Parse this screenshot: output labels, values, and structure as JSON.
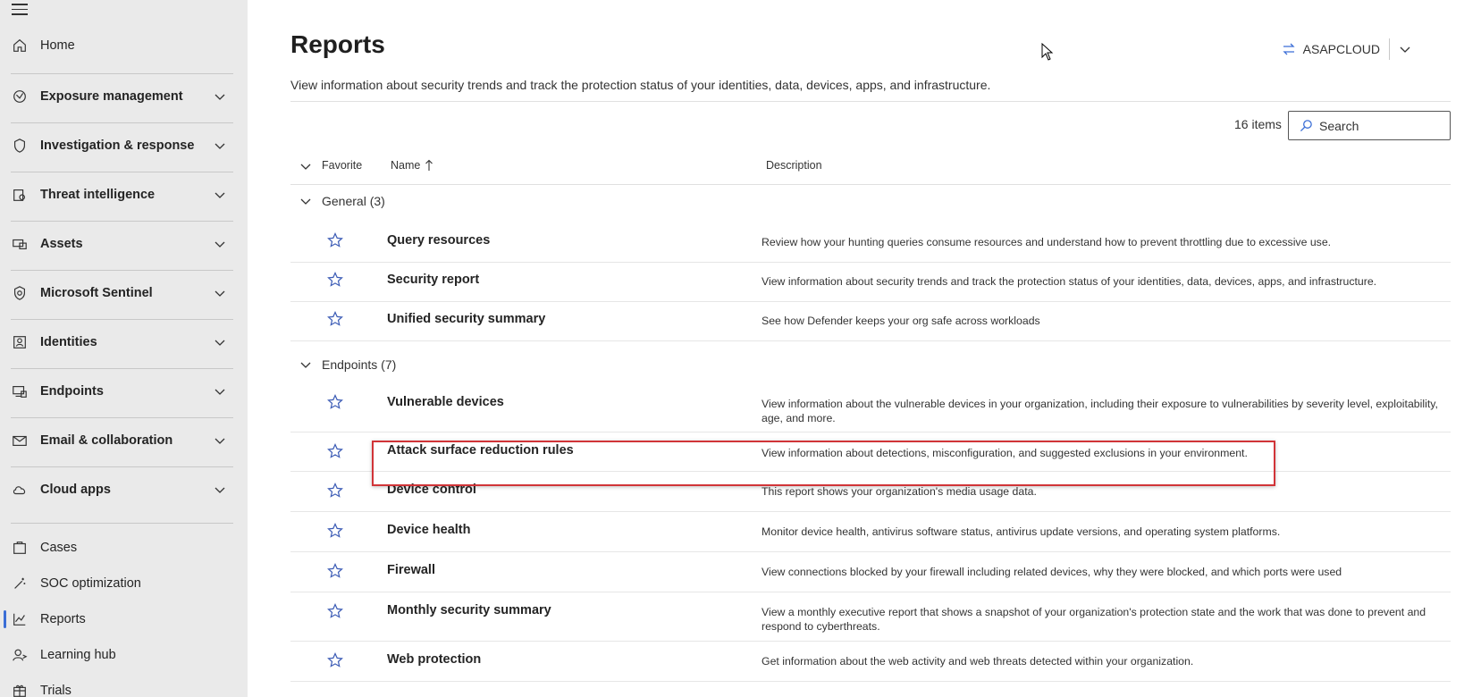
{
  "sidebar": {
    "top_items": [
      {
        "label": "Home",
        "icon": "home-icon"
      }
    ],
    "groups": [
      {
        "label": "Exposure management",
        "icon": "exposure-icon"
      },
      {
        "label": "Investigation & response",
        "icon": "shield-icon"
      },
      {
        "label": "Threat intelligence",
        "icon": "threat-intel-icon"
      },
      {
        "label": "Assets",
        "icon": "assets-icon"
      },
      {
        "label": "Microsoft Sentinel",
        "icon": "sentinel-icon"
      },
      {
        "label": "Identities",
        "icon": "identity-icon"
      },
      {
        "label": "Endpoints",
        "icon": "endpoints-icon"
      },
      {
        "label": "Email & collaboration",
        "icon": "mail-icon"
      },
      {
        "label": "Cloud apps",
        "icon": "cloud-icon"
      }
    ],
    "bottom_items": [
      {
        "label": "Cases",
        "icon": "cases-icon"
      },
      {
        "label": "SOC optimization",
        "icon": "wand-icon"
      },
      {
        "label": "Reports",
        "icon": "chart-icon",
        "active": true
      },
      {
        "label": "Learning hub",
        "icon": "learning-icon"
      },
      {
        "label": "Trials",
        "icon": "trials-icon"
      }
    ]
  },
  "header": {
    "title": "Reports",
    "subtitle": "View information about security trends and track the protection status of your identities, data, devices, apps, and infrastructure.",
    "tenant": "ASAPCLOUD"
  },
  "toolbar": {
    "items_count": "16 items",
    "search_placeholder": "Search"
  },
  "table": {
    "columns": {
      "favorite": "Favorite",
      "name": "Name",
      "description": "Description"
    },
    "groups": [
      {
        "label": "General (3)",
        "rows": [
          {
            "name": "Query resources",
            "description": "Review how your hunting queries consume resources and understand how to prevent throttling due to excessive use."
          },
          {
            "name": "Security report",
            "description": "View information about security trends and track the protection status of your identities, data, devices, apps, and infrastructure."
          },
          {
            "name": "Unified security summary",
            "description": "See how Defender keeps your org safe across workloads"
          }
        ]
      },
      {
        "label": "Endpoints (7)",
        "rows": [
          {
            "name": "Vulnerable devices",
            "description": "View information about the vulnerable devices in your organization, including their exposure to vulnerabilities by severity level, exploitability, age, and more."
          },
          {
            "name": "Attack surface reduction rules",
            "description": "View information about detections, misconfiguration, and suggested exclusions in your environment.",
            "highlighted": true
          },
          {
            "name": "Device control",
            "description": "This report shows your organization's media usage data."
          },
          {
            "name": "Device health",
            "description": "Monitor device health, antivirus software status, antivirus update versions, and operating system platforms."
          },
          {
            "name": "Firewall",
            "description": "View connections blocked by your firewall including related devices, why they were blocked, and which ports were used"
          },
          {
            "name": "Monthly security summary",
            "description": "View a monthly executive report that shows a snapshot of your organization's protection state and the work that was done to prevent and respond to cyberthreats."
          },
          {
            "name": "Web protection",
            "description": "Get information about the web activity and web threats detected within your organization."
          }
        ]
      }
    ]
  },
  "colors": {
    "sidebar_bg": "#eaeaea",
    "accent": "#3b6ed6",
    "star": "#3b5bb5",
    "highlight": "#d13438"
  }
}
